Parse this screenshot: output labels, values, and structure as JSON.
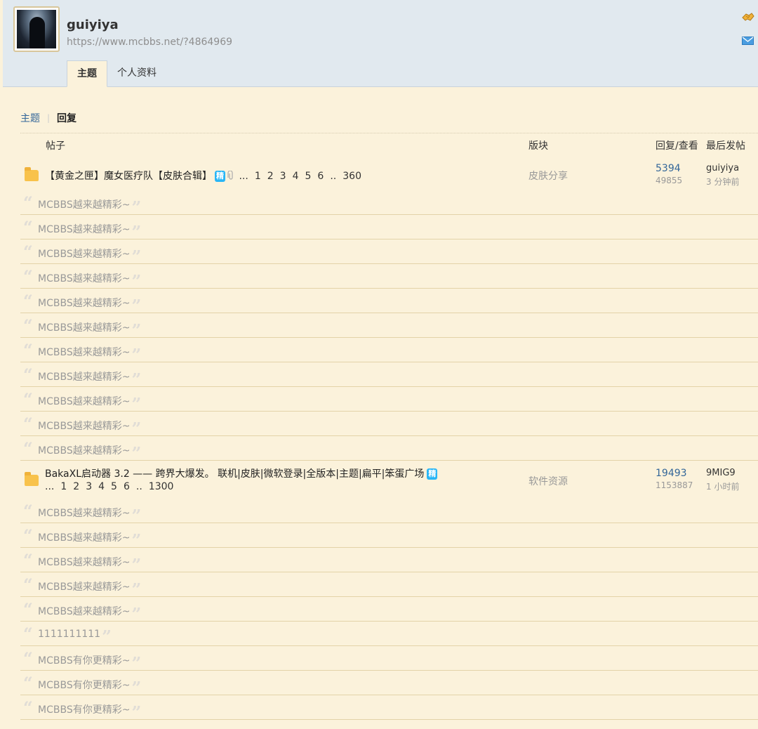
{
  "profile": {
    "username": "guiyiya",
    "url": "https://www.mcbbs.net/?4864969",
    "tabs": [
      "主题",
      "个人资料"
    ]
  },
  "subnav": {
    "topics": "主题",
    "replies": "回复"
  },
  "columns": {
    "post": "帖子",
    "forum": "版块",
    "replies_views": "回复/查看",
    "last_post": "最后发帖"
  },
  "threads": [
    {
      "title": "【黄金之匣】魔女医疗队【皮肤合辑】",
      "badge": "精",
      "pages": [
        "...",
        "1",
        "2",
        "3",
        "4",
        "5",
        "6",
        "..",
        "360"
      ],
      "forum": "皮肤分享",
      "replies": "5394",
      "views": "49855",
      "last_user": "guiyiya",
      "last_time": "3 分钟前",
      "reply_items": [
        "MCBBS越来越精彩~",
        "MCBBS越来越精彩~",
        "MCBBS越来越精彩~",
        "MCBBS越来越精彩~",
        "MCBBS越来越精彩~",
        "MCBBS越来越精彩~",
        "MCBBS越来越精彩~",
        "MCBBS越来越精彩~",
        "MCBBS越来越精彩~",
        "MCBBS越来越精彩~",
        "MCBBS越来越精彩~"
      ]
    },
    {
      "title": "BakaXL启动器 3.2 —— 跨界大爆发。 联机|皮肤|微软登录|全版本|主题|扁平|笨蛋广场",
      "badge": "精",
      "pages": [
        "...",
        "1",
        "2",
        "3",
        "4",
        "5",
        "6",
        "..",
        "1300"
      ],
      "forum": "软件资源",
      "replies": "19493",
      "views": "1153887",
      "last_user": "9MIG9",
      "last_time": "1 小时前",
      "reply_items": [
        "MCBBS越来越精彩~",
        "MCBBS越来越精彩~",
        "MCBBS越来越精彩~",
        "MCBBS越来越精彩~",
        "MCBBS越来越精彩~",
        "1111111111",
        "MCBBS有你更精彩~",
        "MCBBS有你更精彩~",
        "MCBBS有你更精彩~"
      ]
    }
  ]
}
